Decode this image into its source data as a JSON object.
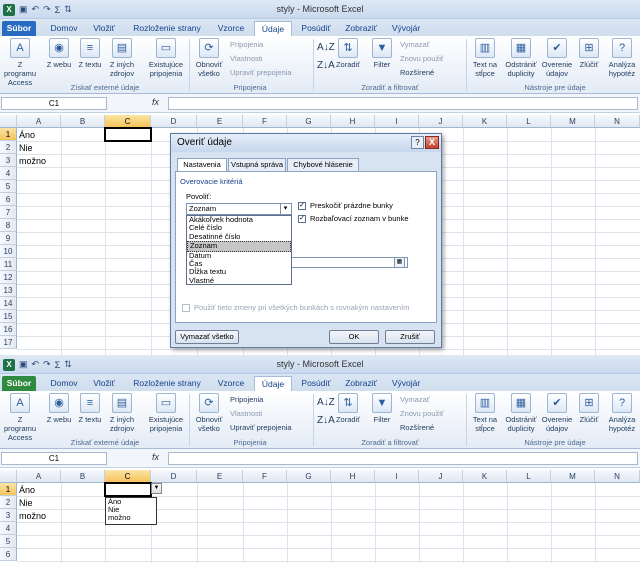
{
  "window": {
    "title": "styly  -  Microsoft Excel",
    "qat_icons": [
      "excel-logo-icon",
      "save-icon",
      "undo-icon",
      "redo-icon",
      "sum-icon",
      "sort-icon"
    ]
  },
  "tabs": [
    "Súbor",
    "Domov",
    "Vložiť",
    "Rozloženie strany",
    "Vzorce",
    "Údaje",
    "Posúdiť",
    "Zobraziť",
    "Vývojár"
  ],
  "ribbon": {
    "groups": {
      "external": "Získať externé údaje",
      "connections": "Pripojenia",
      "sort_filter": "Zoradiť a filtrovať",
      "tools": "Nástroje pre údaje"
    },
    "buttons": {
      "access": "Z programu Access",
      "web": "Z webu",
      "text": "Z textu",
      "other": "Z iných zdrojov",
      "existing": "Existujúce pripojenia",
      "refresh": "Obnoviť všetko",
      "connections": "Pripojenia",
      "properties": "Vlastnosti",
      "edit_links": "Upraviť prepojenia",
      "sort": "Zoradiť",
      "filter": "Filter",
      "clear": "Vymazať",
      "reapply": "Znovu použiť",
      "advanced": "Rozšírené",
      "text_to_columns": "Text na stĺpce",
      "remove_duplicates": "Odstrániť duplicity",
      "validation": "Overenie údajov",
      "consolidate": "Zlúčiť",
      "what_if": "Analýza hypotéz"
    }
  },
  "formula_bar": {
    "name_box": "C1",
    "fx": "fx",
    "formula": ""
  },
  "grid": {
    "columns": [
      "A",
      "B",
      "C",
      "D",
      "E",
      "F",
      "G",
      "H",
      "I",
      "J",
      "K",
      "L",
      "M",
      "N"
    ],
    "rows_top": [
      "1",
      "2",
      "3",
      "4",
      "5",
      "6",
      "7",
      "8",
      "9",
      "10",
      "11",
      "12",
      "13",
      "14",
      "15",
      "16",
      "17"
    ],
    "rows_bottom": [
      "1",
      "2",
      "3",
      "4",
      "5",
      "6"
    ],
    "cells": {
      "A1": "Áno",
      "A2": "Nie",
      "A3": "možno"
    }
  },
  "dialog": {
    "title": "Overiť údaje",
    "help": "?",
    "close": "X",
    "tabs": [
      "Nastavenia",
      "Vstupná správa",
      "Chybové hlásenie"
    ],
    "section": "Overovacie kritériá",
    "allow_label": "Povoliť:",
    "allow_value": "Zoznam",
    "ignore_blank": "Preskočiť prázdne bunky",
    "in_cell_dropdown": "Rozbaľovací zoznam v bunke",
    "options": [
      "Akákoľvek hodnota",
      "Celé číslo",
      "Desatinné číslo",
      "Zoznam",
      "Dátum",
      "Čas",
      "Dĺžka textu",
      "Vlastné"
    ],
    "apply_all": "Použiť tieto zmeny pri všetkých bunkách s rovnakým nastavením",
    "clear_all": "Vymazať všetko",
    "ok": "OK",
    "cancel": "Zrušiť"
  },
  "cell_dropdown": [
    "Áno",
    "Nie",
    "možno"
  ]
}
